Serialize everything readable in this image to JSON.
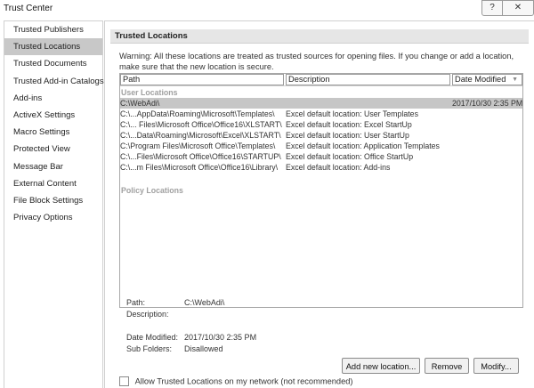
{
  "window": {
    "title": "Trust Center",
    "help_label": "?",
    "close_label": "✕"
  },
  "sidebar": {
    "items": [
      {
        "label": "Trusted Publishers",
        "active": false
      },
      {
        "label": "Trusted Locations",
        "active": true
      },
      {
        "label": "Trusted Documents",
        "active": false
      },
      {
        "label": "Trusted Add-in Catalogs",
        "active": false
      },
      {
        "label": "Add-ins",
        "active": false
      },
      {
        "label": "ActiveX Settings",
        "active": false
      },
      {
        "label": "Macro Settings",
        "active": false
      },
      {
        "label": "Protected View",
        "active": false
      },
      {
        "label": "Message Bar",
        "active": false
      },
      {
        "label": "External Content",
        "active": false
      },
      {
        "label": "File Block Settings",
        "active": false
      },
      {
        "label": "Privacy Options",
        "active": false
      }
    ]
  },
  "main": {
    "section_title": "Trusted Locations",
    "warning": "Warning: All these locations are treated as trusted sources for opening files.  If you change or add a location, make sure that the new location is secure.",
    "columns": {
      "path": "Path",
      "description": "Description",
      "date_modified": "Date Modified"
    },
    "user_locations_label": "User Locations",
    "user_locations": [
      {
        "path": "C:\\WebAdi\\",
        "description": "",
        "date": "2017/10/30 2:35 PM",
        "selected": true
      },
      {
        "path": "C:\\...AppData\\Roaming\\Microsoft\\Templates\\",
        "description": "Excel default location: User Templates",
        "date": "",
        "selected": false
      },
      {
        "path": "C:\\... Files\\Microsoft Office\\Office16\\XLSTART\\",
        "description": "Excel default location: Excel StartUp",
        "date": "",
        "selected": false
      },
      {
        "path": "C:\\...Data\\Roaming\\Microsoft\\Excel\\XLSTART\\",
        "description": "Excel default location: User StartUp",
        "date": "",
        "selected": false
      },
      {
        "path": "C:\\Program Files\\Microsoft Office\\Templates\\",
        "description": "Excel default location: Application Templates",
        "date": "",
        "selected": false
      },
      {
        "path": "C:\\...Files\\Microsoft Office\\Office16\\STARTUP\\",
        "description": "Excel default location: Office StartUp",
        "date": "",
        "selected": false
      },
      {
        "path": "C:\\...m Files\\Microsoft Office\\Office16\\Library\\",
        "description": "Excel default location: Add-ins",
        "date": "",
        "selected": false
      }
    ],
    "policy_locations_label": "Policy Locations",
    "details": {
      "path_label": "Path:",
      "path_value": "C:\\WebAdi\\",
      "description_label": "Description:",
      "description_value": "",
      "date_label": "Date Modified:",
      "date_value": "2017/10/30 2:35 PM",
      "subfolders_label": "Sub Folders:",
      "subfolders_value": "Disallowed"
    },
    "buttons": {
      "add": "Add new location...",
      "remove": "Remove",
      "modify": "Modify..."
    },
    "network_checkbox": {
      "label": "Allow Trusted Locations on my network (not recommended)",
      "checked": false
    }
  }
}
